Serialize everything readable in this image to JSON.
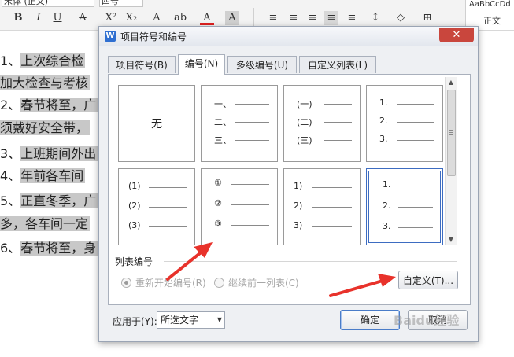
{
  "toolbar": {
    "font_name": "宋体 (正文)",
    "font_size": "四号",
    "bold": "B",
    "italic": "I",
    "underline": "U",
    "strike": "A",
    "superscript": "X²",
    "subscript": "X₂",
    "text_effect": "A",
    "highlight": "ab",
    "font_color": "A",
    "char_shading": "A",
    "style_sample": "AaBbCcDd",
    "style_name": "正文"
  },
  "document": {
    "lines": [
      {
        "marker": "1、",
        "text": "上次综合检"
      },
      {
        "marker": "",
        "text": "加大检查与考核"
      },
      {
        "marker": "2、",
        "text": "春节将至，广"
      },
      {
        "marker": "",
        "text": "须戴好安全带，"
      },
      {
        "marker": "3、",
        "text": "上班期间外出"
      },
      {
        "marker": "4、",
        "text": "年前各车间"
      },
      {
        "marker": "5、",
        "text": "正直冬季，广"
      },
      {
        "marker": "",
        "text": "多，各车间一定"
      },
      {
        "marker": "6、",
        "text": "春节将至，身"
      }
    ]
  },
  "dialog": {
    "title": "项目符号和编号",
    "close": "✕",
    "tabs": [
      "项目符号(B)",
      "编号(N)",
      "多级编号(U)",
      "自定义列表(L)"
    ],
    "active_tab": 1,
    "none_label": "无",
    "presets": [
      {
        "markers": [
          "一、",
          "二、",
          "三、"
        ]
      },
      {
        "markers": [
          "(一)",
          "(二)",
          "(三)"
        ]
      },
      {
        "markers": [
          "1.",
          "2.",
          "3."
        ]
      },
      {
        "markers": [
          "(1)",
          "(2)",
          "(3)"
        ]
      },
      {
        "markers": [
          "①",
          "②",
          "③"
        ]
      },
      {
        "markers": [
          "1)",
          "2)",
          "3)"
        ]
      },
      {
        "markers": [
          "1.",
          "2.",
          "3."
        ]
      }
    ],
    "selected_preset": 6,
    "list_numbering_label": "列表编号",
    "radio_restart": "重新开始编号(R)",
    "radio_continue": "继续前一列表(C)",
    "customize_button": "自定义(T)...",
    "apply_to_label": "应用于(Y):",
    "apply_to_value": "所选文字",
    "ok_button": "确定",
    "cancel_button": "取消"
  },
  "watermark": "Baidu经验",
  "colors": {
    "arrow": "#e8322b",
    "selection": "#3d6cc1",
    "close_button": "#c9463d"
  }
}
